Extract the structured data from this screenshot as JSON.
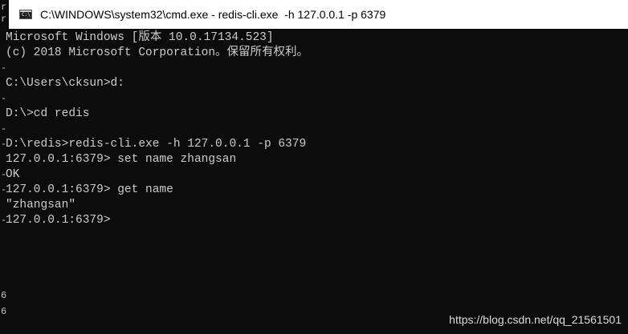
{
  "window": {
    "title": "C:\\WINDOWS\\system32\\cmd.exe - redis-cli.exe  -h 127.0.0.1 -p 6379",
    "icon": "cmd-app-icon",
    "icon_text": "C:\\"
  },
  "console": {
    "lines": [
      "Microsoft Windows [版本 10.0.17134.523]",
      "(c) 2018 Microsoft Corporation。保留所有权利。",
      "",
      "C:\\Users\\cksun>d:",
      "",
      "D:\\>cd redis",
      "",
      "D:\\redis>redis-cli.exe -h 127.0.0.1 -p 6379",
      "127.0.0.1:6379> set name zhangsan",
      "OK",
      "127.0.0.1:6379> get name",
      "\"zhangsan\"",
      "127.0.0.1:6379>"
    ]
  },
  "watermark": {
    "text": "https://blog.csdn.net/qq_21561501"
  }
}
